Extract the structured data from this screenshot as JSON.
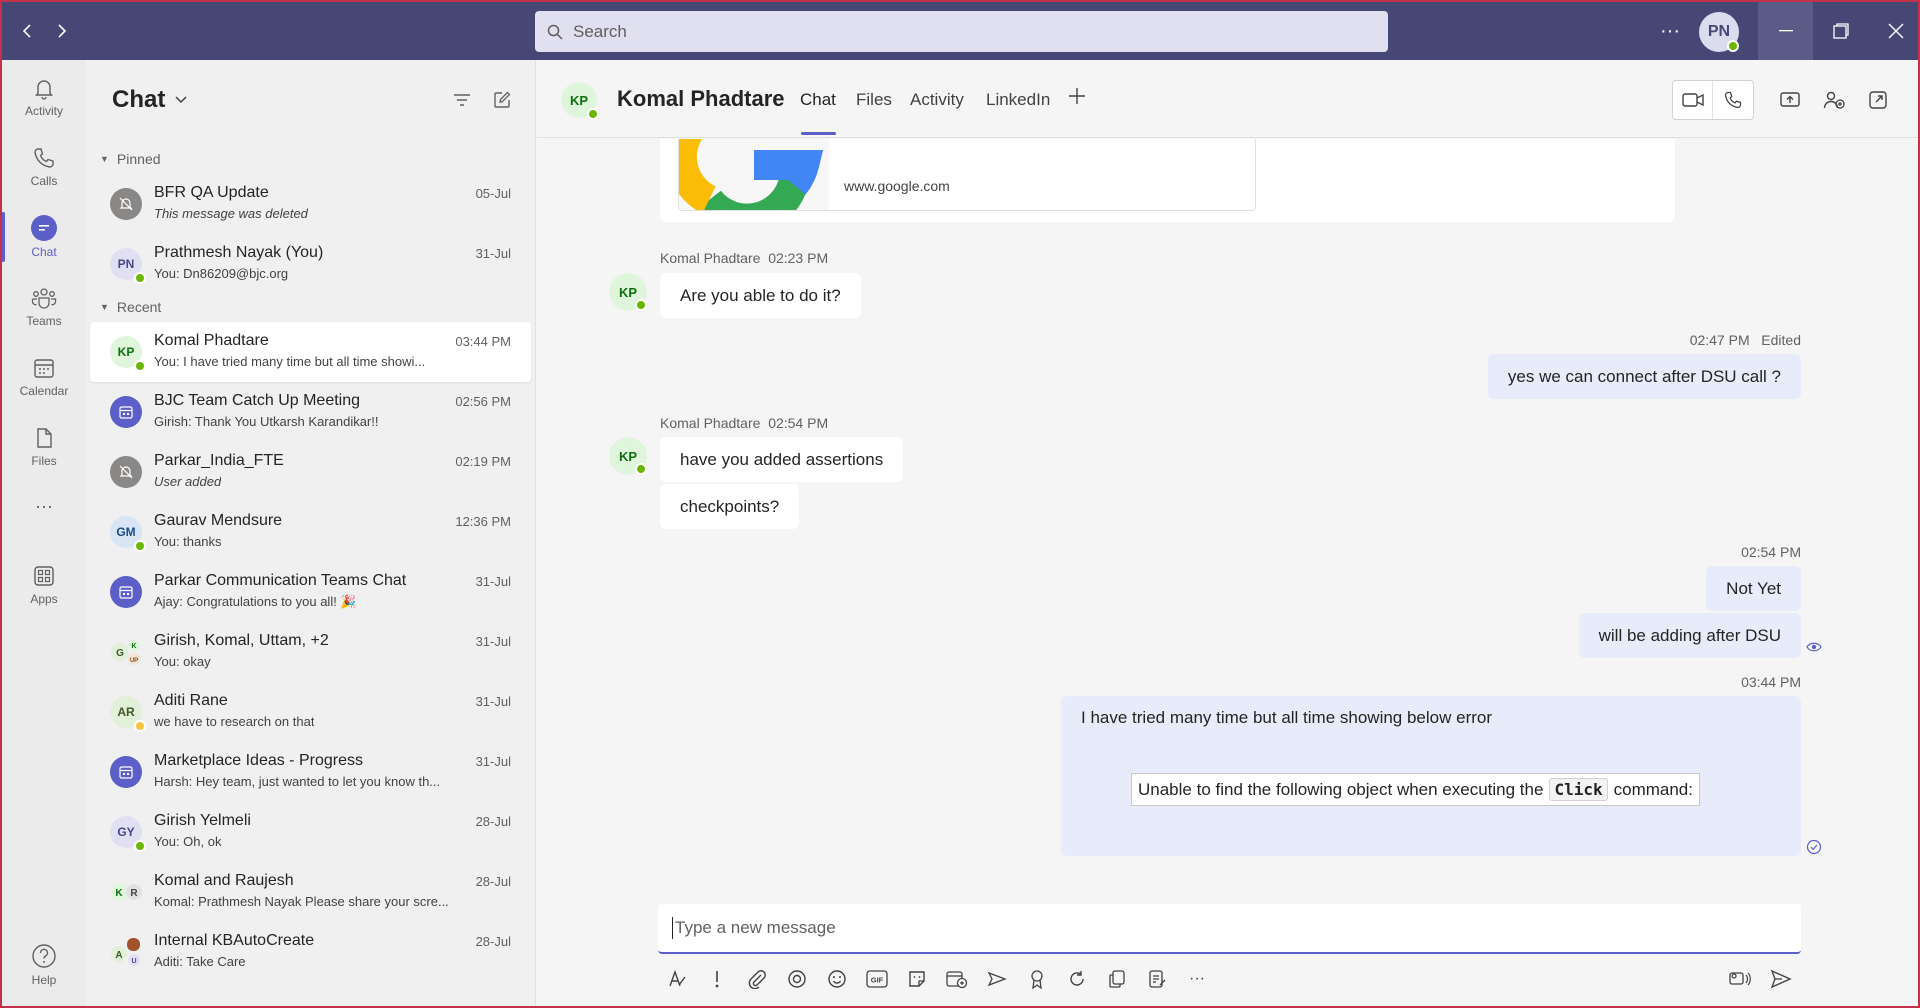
{
  "titlebar": {
    "search_placeholder": "Search",
    "user_initials": "PN"
  },
  "rail": [
    {
      "label": "Activity",
      "icon": "bell-icon"
    },
    {
      "label": "Calls",
      "icon": "phone-icon"
    },
    {
      "label": "Chat",
      "icon": "chat-icon",
      "active": true
    },
    {
      "label": "Teams",
      "icon": "teams-icon"
    },
    {
      "label": "Calendar",
      "icon": "calendar-icon"
    },
    {
      "label": "Files",
      "icon": "file-icon"
    },
    {
      "label": "Apps",
      "icon": "apps-icon"
    },
    {
      "label": "Help",
      "icon": "help-icon"
    }
  ],
  "list": {
    "title": "Chat",
    "pinned_label": "Pinned",
    "recent_label": "Recent",
    "pinned": [
      {
        "name": "BFR QA Update",
        "preview": "This message was deleted",
        "time": "05-Jul"
      },
      {
        "name": "Prathmesh Nayak (You)",
        "preview": "You: Dn86209@bjc.org",
        "time": "31-Jul",
        "initials": "PN"
      }
    ],
    "recent": [
      {
        "name": "Komal Phadtare",
        "preview": "You: I have tried many time but all time showi...",
        "time": "03:44 PM",
        "initials": "KP"
      },
      {
        "name": "BJC Team Catch Up Meeting",
        "preview": "Girish: Thank You Utkarsh Karandikar!!",
        "time": "02:56 PM"
      },
      {
        "name": "Parkar_India_FTE",
        "preview": "User added",
        "time": "02:19 PM"
      },
      {
        "name": "Gaurav Mendsure",
        "preview": "You: thanks",
        "time": "12:36 PM",
        "initials": "GM"
      },
      {
        "name": "Parkar Communication Teams Chat",
        "preview": "Ajay: Congratulations to you all! 🎉",
        "time": "31-Jul"
      },
      {
        "name": "Girish, Komal, Uttam, +2",
        "preview": "You: okay",
        "time": "31-Jul"
      },
      {
        "name": "Aditi Rane",
        "preview": "we have to research on that",
        "time": "31-Jul",
        "initials": "AR"
      },
      {
        "name": "Marketplace Ideas - Progress",
        "preview": "Harsh: Hey team, just wanted to let you know th...",
        "time": "31-Jul"
      },
      {
        "name": "Girish Yelmeli",
        "preview": "You: Oh, ok",
        "time": "28-Jul",
        "initials": "GY"
      },
      {
        "name": "Komal and Raujesh",
        "preview": "Komal: Prathmesh Nayak Please share your scre...",
        "time": "28-Jul"
      },
      {
        "name": "Internal KBAutoCreate",
        "preview": "Aditi: Take Care",
        "time": "28-Jul"
      }
    ]
  },
  "header": {
    "initials": "KP",
    "name": "Komal Phadtare",
    "tabs": [
      "Chat",
      "Files",
      "Activity",
      "LinkedIn"
    ]
  },
  "messages": {
    "link_url": "www.google.com",
    "m1": {
      "sender": "Komal Phadtare",
      "time": "02:23 PM",
      "text": "Are you able to do it?",
      "initials": "KP"
    },
    "m2": {
      "time": "02:47 PM",
      "edited": "Edited",
      "text": "yes we can connect after DSU call ?"
    },
    "m3": {
      "sender": "Komal Phadtare",
      "time": "02:54 PM",
      "text1": "have you added assertions",
      "text2": "checkpoints?",
      "initials": "KP"
    },
    "m4": {
      "time": "02:54 PM",
      "text1": "Not Yet",
      "text2": "will be adding after DSU"
    },
    "m5": {
      "time": "03:44 PM",
      "text": "I have tried many time but all time showing below error",
      "err_before": "Unable to find the following object when executing the",
      "err_code": "Click",
      "err_after": "command:"
    }
  },
  "compose": {
    "placeholder": "Type a new message"
  }
}
